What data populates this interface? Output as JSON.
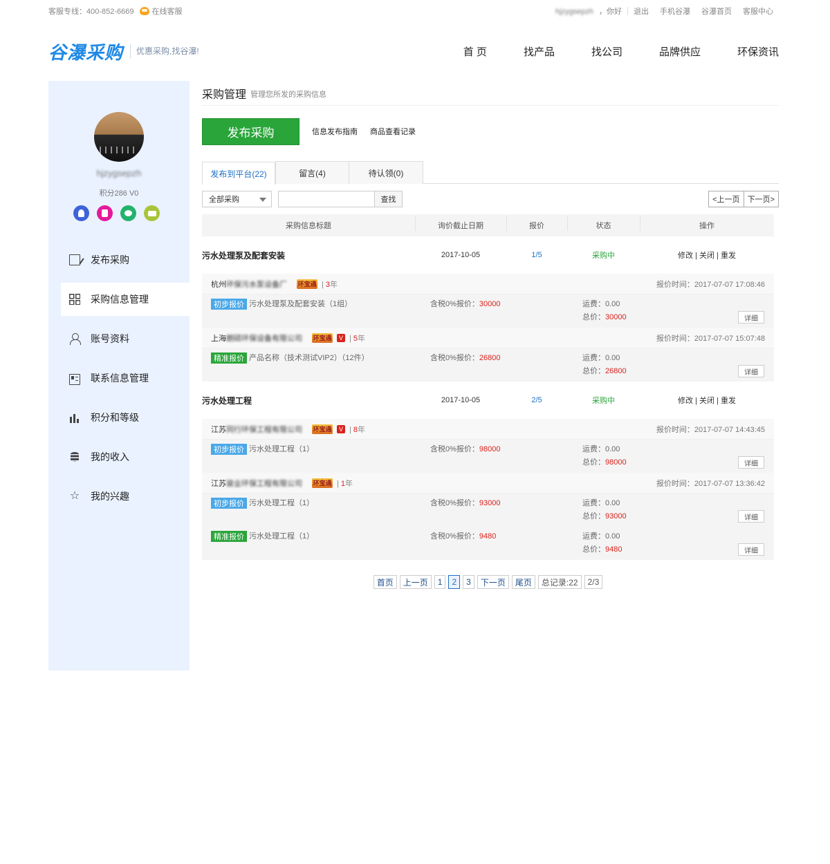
{
  "topbar": {
    "hotline": "客服专线：400-852-6669",
    "online_service": "在线客服",
    "greeting_user": "hjzygsepzh",
    "greeting_suffix": "，你好",
    "logout": "退出",
    "mobile": "手机谷瀑",
    "home": "谷瀑首页",
    "service_center": "客服中心"
  },
  "header": {
    "logo": "谷瀑采购",
    "slogan": "优惠采购,找谷瀑!",
    "nav": [
      "首 页",
      "找产品",
      "找公司",
      "品牌供应",
      "环保资讯"
    ]
  },
  "sidebar": {
    "username": "hjzygsepzh",
    "points": "积分286 V0",
    "menu": [
      "发布采购",
      "采购信息管理",
      "账号资料",
      "联系信息管理",
      "积分和等级",
      "我的收入",
      "我的兴趣"
    ]
  },
  "main": {
    "title": "采购管理",
    "subtitle": "管理您所发的采购信息",
    "publish_btn": "发布采购",
    "guide_link": "信息发布指南",
    "history_link": "商品查看记录",
    "tabs": [
      "发布到平台(22)",
      "留言(4)",
      "待认领(0)"
    ],
    "filter_select": "全部采购",
    "search_placeholder": "",
    "search_btn": "查找",
    "prev_page": "<上一页",
    "next_page": "下一页>",
    "columns": [
      "采购信息标题",
      "询价截止日期",
      "报价",
      "状态",
      "操作"
    ]
  },
  "groups": [
    {
      "title": "污水处理泵及配套安装",
      "date": "2017-10-05",
      "quotes": "1/5",
      "status": "采购中",
      "ops": "修改 | 关闭 | 重发",
      "offers": [
        {
          "company_prefix": "杭州",
          "company_blur": "环保污水泵设备厂",
          "hbt": "环宝通",
          "vip": "",
          "years_num": "3",
          "years_unit": "年",
          "time_label": "报价时间：",
          "time": "2017-07-07 17:08:46",
          "lines": [
            {
              "tag": "初步报价",
              "tag_type": "init",
              "product": "污水处理泵及配套安装（1组）",
              "price_label": "含税0%报价：",
              "price": "30000",
              "freight_label": "运费：",
              "freight": "0.00",
              "total_label": "总价：",
              "total": "30000",
              "detail": "详细"
            }
          ]
        },
        {
          "company_prefix": "上海",
          "company_blur": "朗硕环保设备有限公司",
          "hbt": "环宝通",
          "vip": "V",
          "years_num": "5",
          "years_unit": "年",
          "time_label": "报价时间：",
          "time": "2017-07-07 15:07:48",
          "lines": [
            {
              "tag": "精准报价",
              "tag_type": "exact",
              "product": "产品名称（技术测试VIP2）（12件）",
              "price_label": "含税0%报价：",
              "price": "26800",
              "freight_label": "运费：",
              "freight": "0.00",
              "total_label": "总价：",
              "total": "26800",
              "detail": "详细"
            }
          ]
        }
      ]
    },
    {
      "title": "污水处理工程",
      "date": "2017-10-05",
      "quotes": "2/5",
      "status": "采购中",
      "ops": "修改 | 关闭 | 重发",
      "offers": [
        {
          "company_prefix": "江苏",
          "company_blur": "同行环保工程有限公司",
          "hbt": "环宝通",
          "vip": "V",
          "years_num": "8",
          "years_unit": "年",
          "time_label": "报价时间：",
          "time": "2017-07-07 14:43:45",
          "lines": [
            {
              "tag": "初步报价",
              "tag_type": "init",
              "product": "污水处理工程（1）",
              "price_label": "含税0%报价：",
              "price": "98000",
              "freight_label": "运费：",
              "freight": "0.00",
              "total_label": "总价：",
              "total": "98000",
              "detail": "详细"
            }
          ]
        },
        {
          "company_prefix": "江苏",
          "company_blur": "骏业环保工程有限公司",
          "hbt": "环宝通",
          "vip": "",
          "years_num": "1",
          "years_unit": "年",
          "time_label": "报价时间：",
          "time": "2017-07-07 13:36:42",
          "lines": [
            {
              "tag": "初步报价",
              "tag_type": "init",
              "product": "污水处理工程（1）",
              "price_label": "含税0%报价：",
              "price": "93000",
              "freight_label": "运费：",
              "freight": "0.00",
              "total_label": "总价：",
              "total": "93000",
              "detail": "详细"
            },
            {
              "tag": "精准报价",
              "tag_type": "exact",
              "product": "污水处理工程（1）",
              "price_label": "含税0%报价：",
              "price": "9480",
              "freight_label": "运费：",
              "freight": "0.00",
              "total_label": "总价：",
              "total": "9480",
              "detail": "详细"
            }
          ]
        }
      ]
    }
  ],
  "pagination": {
    "first": "首页",
    "prev": "上一页",
    "pages": [
      "1",
      "2",
      "3"
    ],
    "current": "2",
    "next": "下一页",
    "last": "尾页",
    "total": "总记录:22",
    "ratio": "2/3"
  }
}
